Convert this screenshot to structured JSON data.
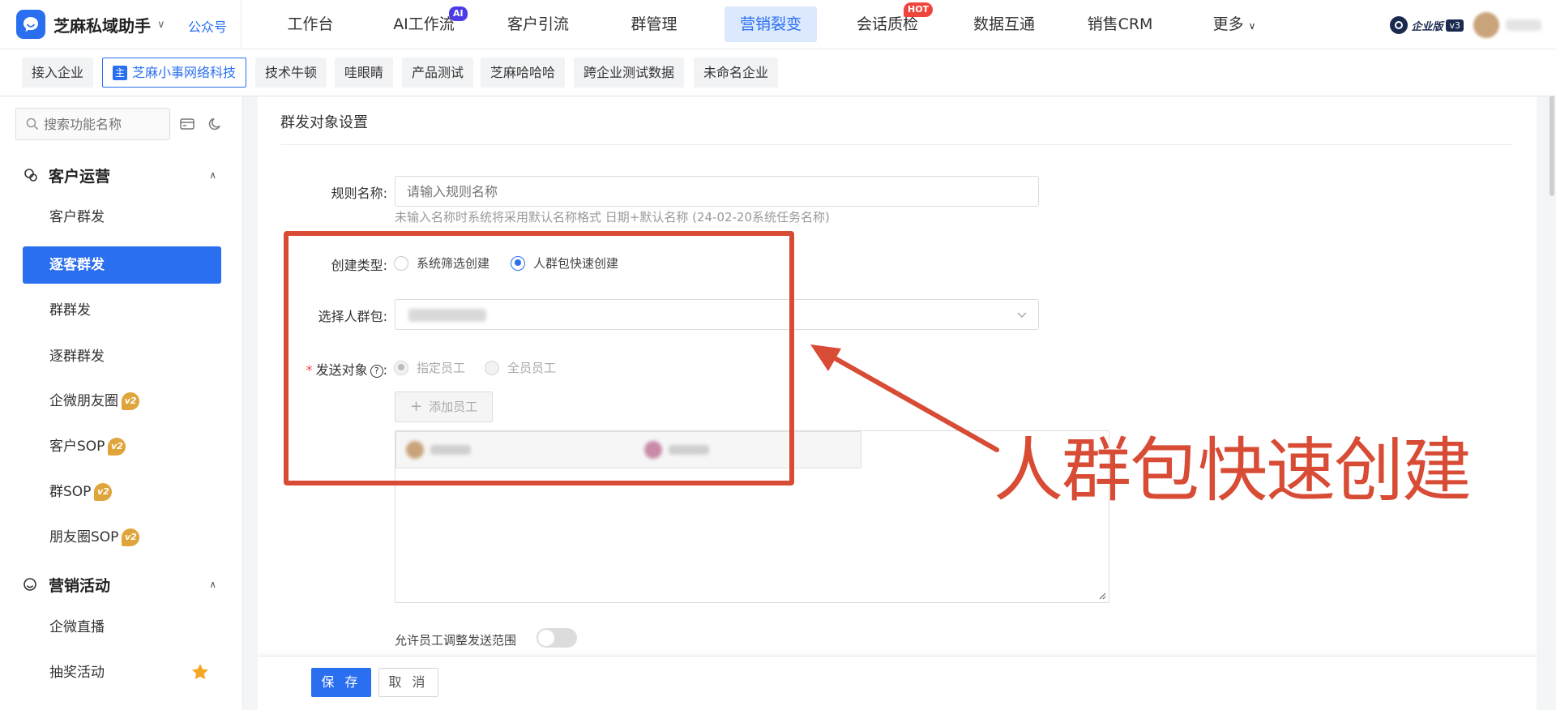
{
  "brand": {
    "name": "芝麻私域助手",
    "sub": "公众号",
    "color": "#2a6ff0"
  },
  "nav": {
    "items": [
      {
        "label": "工作台"
      },
      {
        "label": "AI工作流",
        "badge": "AI"
      },
      {
        "label": "客户引流"
      },
      {
        "label": "群管理"
      },
      {
        "label": "营销裂变",
        "active": true
      },
      {
        "label": "会话质检",
        "badge": "HOT"
      },
      {
        "label": "数据互通"
      },
      {
        "label": "销售CRM"
      },
      {
        "label": "更多"
      }
    ]
  },
  "edition": {
    "label": "企业版",
    "version": "v3"
  },
  "tabs": [
    {
      "label": "接入企业"
    },
    {
      "label": "芝麻小事网络科技",
      "active": true,
      "icon": "主"
    },
    {
      "label": "技术牛顿"
    },
    {
      "label": "哇眼睛"
    },
    {
      "label": "产品测试"
    },
    {
      "label": "芝麻哈哈哈"
    },
    {
      "label": "跨企业测试数据"
    },
    {
      "label": "未命名企业"
    }
  ],
  "sidebar": {
    "search_placeholder": "搜索功能名称",
    "groups": [
      {
        "label": "客户运营",
        "icon": "customer-ops-icon",
        "items": [
          {
            "label": "客户群发"
          },
          {
            "label": "逐客群发",
            "active": true
          },
          {
            "label": "群群发"
          },
          {
            "label": "逐群群发"
          },
          {
            "label": "企微朋友圈",
            "badge": "v2"
          },
          {
            "label": "客户SOP",
            "badge": "v2"
          },
          {
            "label": "群SOP",
            "badge": "v2"
          },
          {
            "label": "朋友圈SOP",
            "badge": "v2"
          }
        ]
      },
      {
        "label": "营销活动",
        "icon": "marketing-icon",
        "items": [
          {
            "label": "企微直播"
          },
          {
            "label": "抽奖活动",
            "icon": "star-icon"
          }
        ]
      }
    ],
    "badge_text": "v2"
  },
  "form": {
    "section_title": "群发对象设置",
    "rule_name": {
      "label": "规则名称",
      "placeholder": "请输入规则名称",
      "hint": "未输入名称时系统将采用默认名称格式 日期+默认名称 (24-02-20系统任务名称)"
    },
    "create_type": {
      "label": "创建类型",
      "options": [
        "系统筛选创建",
        "人群包快速创建"
      ],
      "selected": "人群包快速创建"
    },
    "crowd_pack": {
      "label": "选择人群包"
    },
    "send_target": {
      "label": "发送对象",
      "required": true,
      "options": [
        "指定员工",
        "全员员工"
      ],
      "selected": "指定员工",
      "add_button": "添加员工"
    },
    "adjust_scope": {
      "label": "允许员工调整发送范围",
      "enabled": false
    }
  },
  "footer": {
    "save": "保 存",
    "cancel": "取 消"
  },
  "annotation": {
    "text": "人群包快速创建",
    "color": "#d84b35"
  }
}
